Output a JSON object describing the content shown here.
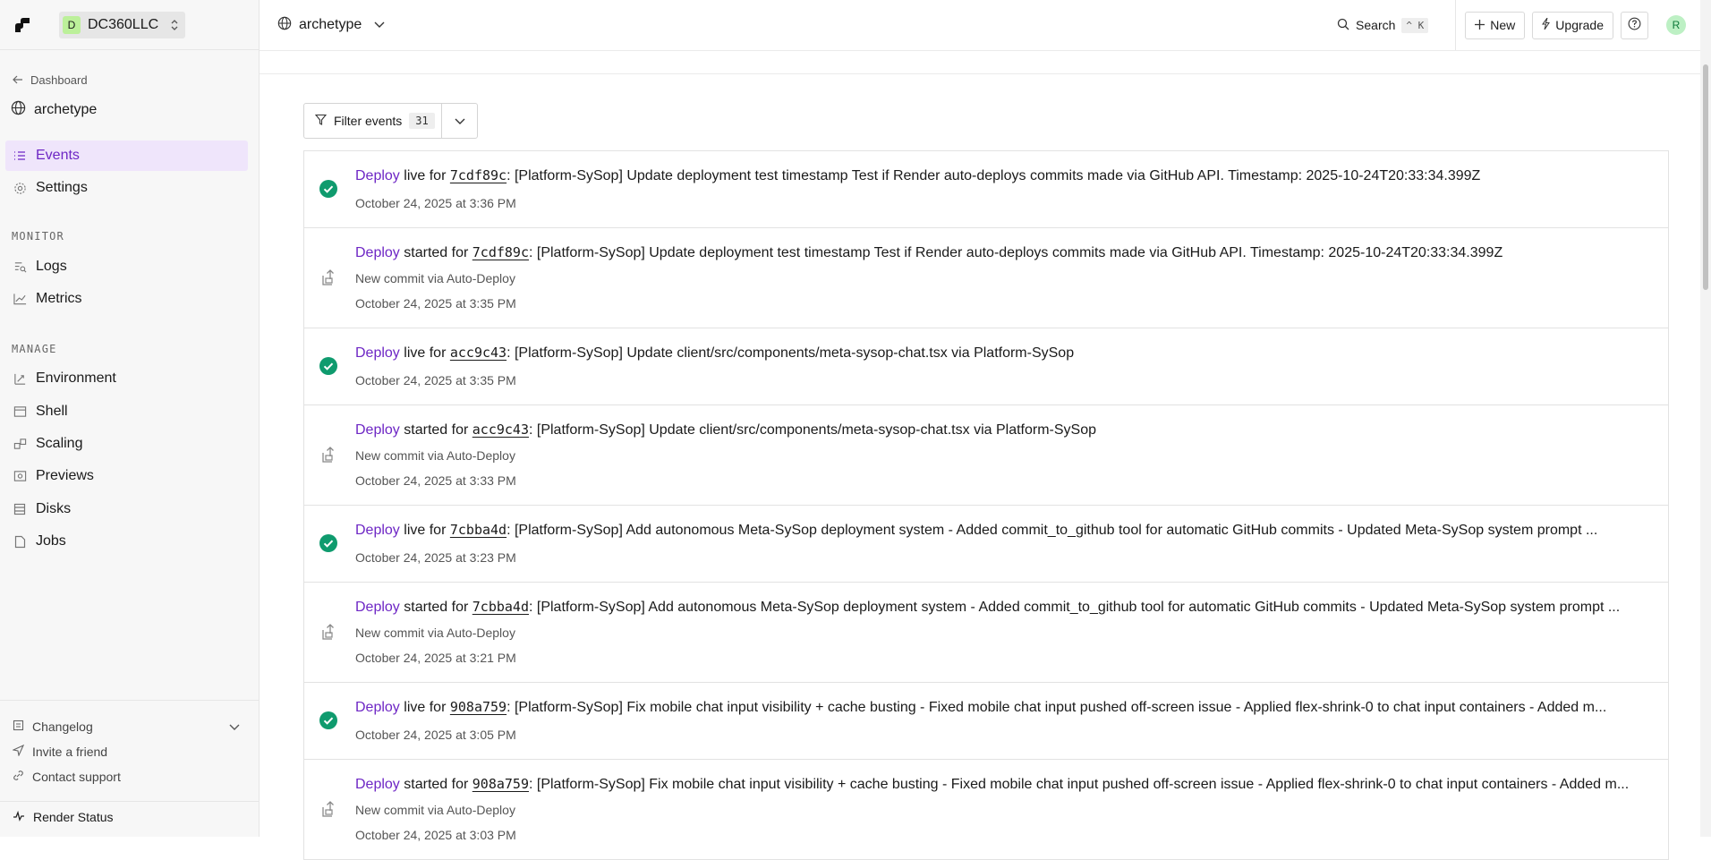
{
  "workspace": {
    "initial": "D",
    "name": "DC360LLC"
  },
  "topbar": {
    "project": "archetype",
    "search_label": "Search",
    "search_shortcut": "^ K",
    "new_label": "New",
    "upgrade_label": "Upgrade",
    "user_initial": "R"
  },
  "sidebar": {
    "back_label": "Dashboard",
    "service_name": "archetype",
    "primary": [
      {
        "label": "Events",
        "icon": "list-icon"
      },
      {
        "label": "Settings",
        "icon": "gear-icon"
      }
    ],
    "monitor_title": "MONITOR",
    "monitor": [
      {
        "label": "Logs",
        "icon": "logs-icon"
      },
      {
        "label": "Metrics",
        "icon": "chart-icon"
      }
    ],
    "manage_title": "MANAGE",
    "manage": [
      {
        "label": "Environment",
        "icon": "env-icon"
      },
      {
        "label": "Shell",
        "icon": "shell-icon"
      },
      {
        "label": "Scaling",
        "icon": "scaling-icon"
      },
      {
        "label": "Previews",
        "icon": "previews-icon"
      },
      {
        "label": "Disks",
        "icon": "disks-icon"
      },
      {
        "label": "Jobs",
        "icon": "jobs-icon"
      }
    ],
    "bottom": {
      "changelog": "Changelog",
      "invite": "Invite a friend",
      "support": "Contact support",
      "status": "Render Status"
    }
  },
  "filter": {
    "label": "Filter events",
    "count": "31"
  },
  "events": [
    {
      "status": "live",
      "deploy": "Deploy",
      "verb": "live",
      "for": "for",
      "sha": "7cdf89c",
      "message": ": [Platform-SySop] Update deployment test timestamp Test if Render auto-deploys commits made via GitHub API. Timestamp: 2025-10-24T20:33:34.399Z",
      "sub": "",
      "time": "October 24, 2025 at 3:36 PM"
    },
    {
      "status": "started",
      "deploy": "Deploy",
      "verb": "started",
      "for": "for",
      "sha": "7cdf89c",
      "message": ": [Platform-SySop] Update deployment test timestamp Test if Render auto-deploys commits made via GitHub API. Timestamp: 2025-10-24T20:33:34.399Z",
      "sub": "New commit via Auto-Deploy",
      "time": "October 24, 2025 at 3:35 PM"
    },
    {
      "status": "live",
      "deploy": "Deploy",
      "verb": "live",
      "for": "for",
      "sha": "acc9c43",
      "message": ": [Platform-SySop] Update client/src/components/meta-sysop-chat.tsx via Platform-SySop",
      "sub": "",
      "time": "October 24, 2025 at 3:35 PM"
    },
    {
      "status": "started",
      "deploy": "Deploy",
      "verb": "started",
      "for": "for",
      "sha": "acc9c43",
      "message": ": [Platform-SySop] Update client/src/components/meta-sysop-chat.tsx via Platform-SySop",
      "sub": "New commit via Auto-Deploy",
      "time": "October 24, 2025 at 3:33 PM"
    },
    {
      "status": "live",
      "deploy": "Deploy",
      "verb": "live",
      "for": "for",
      "sha": "7cbba4d",
      "message": ": [Platform-SySop] Add autonomous Meta-SySop deployment system - Added commit_to_github tool for automatic GitHub commits - Updated Meta-SySop system prompt ...",
      "sub": "",
      "time": "October 24, 2025 at 3:23 PM"
    },
    {
      "status": "started",
      "deploy": "Deploy",
      "verb": "started",
      "for": "for",
      "sha": "7cbba4d",
      "message": ": [Platform-SySop] Add autonomous Meta-SySop deployment system - Added commit_to_github tool for automatic GitHub commits - Updated Meta-SySop system prompt ...",
      "sub": "New commit via Auto-Deploy",
      "time": "October 24, 2025 at 3:21 PM"
    },
    {
      "status": "live",
      "deploy": "Deploy",
      "verb": "live",
      "for": "for",
      "sha": "908a759",
      "message": ": [Platform-SySop] Fix mobile chat input visibility + cache busting - Fixed mobile chat input pushed off-screen issue - Applied flex-shrink-0 to chat input containers - Added m...",
      "sub": "",
      "time": "October 24, 2025 at 3:05 PM"
    },
    {
      "status": "started",
      "deploy": "Deploy",
      "verb": "started",
      "for": "for",
      "sha": "908a759",
      "message": ": [Platform-SySop] Fix mobile chat input visibility + cache busting - Fixed mobile chat input pushed off-screen issue - Applied flex-shrink-0 to chat input containers - Added m...",
      "sub": "New commit via Auto-Deploy",
      "time": "October 24, 2025 at 3:03 PM"
    }
  ],
  "colors": {
    "accent": "#6e27c5",
    "success": "#0f9b6e",
    "active_bg": "#efe5fb"
  }
}
